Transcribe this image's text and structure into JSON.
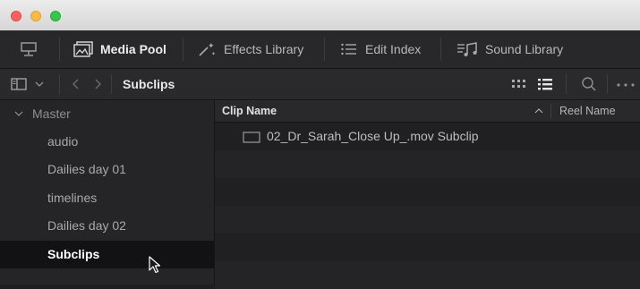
{
  "toolbar": {
    "media_pool": "Media Pool",
    "effects_library": "Effects Library",
    "edit_index": "Edit Index",
    "sound_library": "Sound Library"
  },
  "pathbar": {
    "current_bin": "Subclips"
  },
  "sidebar": {
    "root": "Master",
    "items": [
      {
        "label": "audio"
      },
      {
        "label": "Dailies day 01"
      },
      {
        "label": "timelines"
      },
      {
        "label": "Dailies day 02"
      },
      {
        "label": "Subclips",
        "selected": true
      }
    ]
  },
  "list": {
    "columns": [
      "Clip Name",
      "Reel Name"
    ],
    "rows": [
      {
        "clip_name": "02_Dr_Sarah_Close Up_.mov Subclip",
        "icon": "clip-icon"
      }
    ]
  },
  "colors": {
    "close": "#fc605c",
    "minimize": "#fdbc40",
    "zoom": "#34c84a",
    "selection": "#121214",
    "background": "#1e1e20"
  }
}
